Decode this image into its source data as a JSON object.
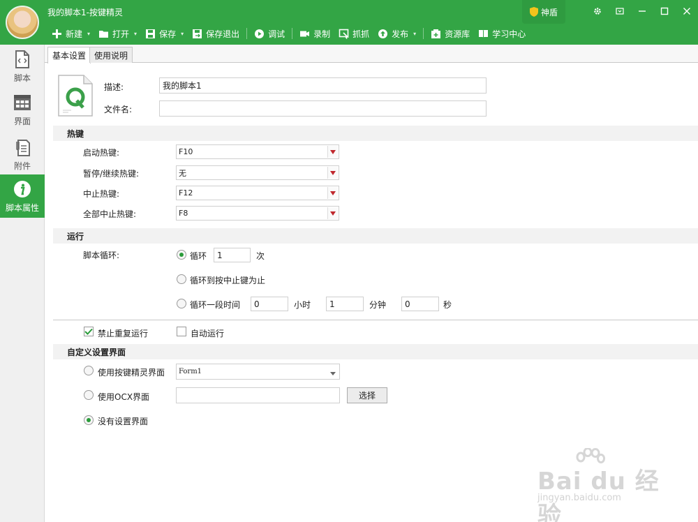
{
  "app": {
    "title": "我的脚本1-按键精灵",
    "shield_label": "神盾"
  },
  "toolbar": {
    "items": [
      {
        "label": "新建",
        "icon": "plus-icon",
        "dropdown": true
      },
      {
        "label": "打开",
        "icon": "folder-icon",
        "dropdown": true
      },
      {
        "label": "保存",
        "icon": "save-icon",
        "dropdown": true
      },
      {
        "label": "保存退出",
        "icon": "save-exit-icon"
      },
      {
        "label": "调试",
        "icon": "play-icon"
      },
      {
        "label": "录制",
        "icon": "camera-icon"
      },
      {
        "label": "抓抓",
        "icon": "grab-icon"
      },
      {
        "label": "发布",
        "icon": "publish-icon",
        "dropdown": true
      },
      {
        "label": "资源库",
        "icon": "resource-icon"
      },
      {
        "label": "学习中心",
        "icon": "book-icon"
      }
    ]
  },
  "sidebar": {
    "items": [
      {
        "label": "脚本",
        "icon": "script-icon"
      },
      {
        "label": "界面",
        "icon": "grid-icon"
      },
      {
        "label": "附件",
        "icon": "attachment-icon"
      },
      {
        "label": "脚本属性",
        "icon": "info-icon",
        "active": true
      }
    ]
  },
  "tabs": {
    "basic": "基本设置",
    "usage": "使用说明"
  },
  "form": {
    "desc_label": "描述:",
    "desc_value": "我的脚本1",
    "filename_label": "文件名:",
    "filename_value": ""
  },
  "hotkeys": {
    "title": "热键",
    "rows": [
      {
        "label": "启动热键:",
        "value": "F10"
      },
      {
        "label": "暂停/继续热键:",
        "value": "无"
      },
      {
        "label": "中止热键:",
        "value": "F12"
      },
      {
        "label": "全部中止热键:",
        "value": "F8"
      }
    ]
  },
  "run": {
    "title": "运行",
    "loop_label": "脚本循环:",
    "opt_loop": "循环",
    "loop_count": "1",
    "times_unit": "次",
    "opt_until_stop": "循环到按中止键为止",
    "opt_duration": "循环一段时间",
    "hours": "0",
    "hours_unit": "小时",
    "minutes": "1",
    "minutes_unit": "分钟",
    "seconds": "0",
    "seconds_unit": "秒",
    "no_repeat_label": "禁止重复运行",
    "auto_run_label": "自动运行"
  },
  "custom_ui": {
    "title": "自定义设置界面",
    "opt_builtin": "使用按键精灵界面",
    "builtin_value": "Form1",
    "opt_ocx": "使用OCX界面",
    "ocx_value": "",
    "select_button": "选择",
    "opt_none": "没有设置界面"
  },
  "watermark": {
    "brand": "Bai du 经验",
    "url": "jingyan.baidu.com"
  },
  "colors": {
    "accent": "#33a545",
    "radio_selected": "#2a9b3a",
    "arrow_red": "#c0272d"
  }
}
